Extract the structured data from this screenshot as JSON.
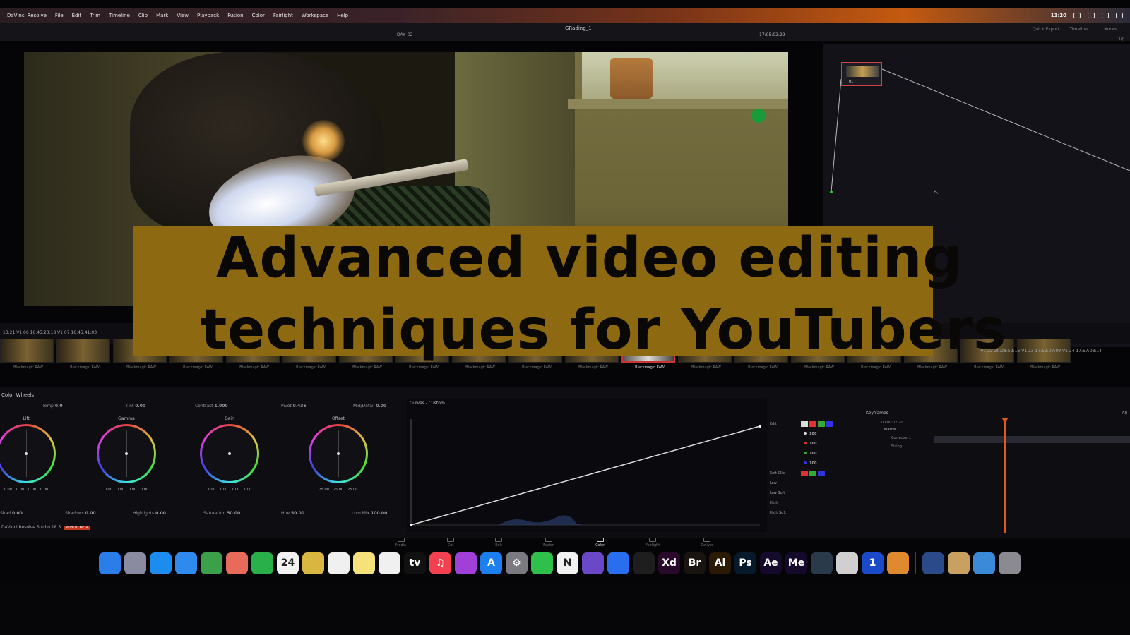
{
  "menubar": {
    "items": [
      "DaVinci Resolve",
      "File",
      "Edit",
      "Trim",
      "Timeline",
      "Clip",
      "Mark",
      "View",
      "Playback",
      "Fusion",
      "Color",
      "Fairlight",
      "Workspace",
      "Help"
    ],
    "clock": "11:20"
  },
  "toolbar": {
    "project": "GRading_1",
    "clip": "DAY_02",
    "timecode": "17:05:02:22",
    "quick_export": "Quick Export",
    "timeline_label": "Timeline",
    "nodes_label": "Nodes",
    "clip_label": "Clip"
  },
  "node": {
    "number": "01"
  },
  "banner": {
    "line1": "Advanced video editing",
    "line2": "techniques for YouTubers",
    "bg_color": "#8d6a12"
  },
  "timeline": {
    "left_tc": "13:21   V1   06   16:45:23:18   V1   07   16:45:41:03",
    "right_tc": "V1  22  20:28:52:16   V1  23  17:52:07:09   V1  24  17:57:08:14",
    "clip_label": "Blackmagic RAW",
    "selected_index": 11,
    "clip_count": 19
  },
  "color": {
    "panel_title": "Color Wheels",
    "params_top": [
      {
        "label": "Temp",
        "value": "0.0"
      },
      {
        "label": "Tint",
        "value": "0.00"
      },
      {
        "label": "Contrast",
        "value": "1.000"
      },
      {
        "label": "Pivot",
        "value": "0.435"
      },
      {
        "label": "Mid/Detail",
        "value": "0.00"
      }
    ],
    "wheels": [
      {
        "label": "Lift",
        "values": [
          "0.00",
          "0.00",
          "0.00",
          "0.00"
        ]
      },
      {
        "label": "Gamma",
        "values": [
          "0.00",
          "0.00",
          "0.00",
          "0.00"
        ]
      },
      {
        "label": "Gain",
        "values": [
          "1.00",
          "1.00",
          "1.00",
          "1.00"
        ]
      },
      {
        "label": "Offset",
        "values": [
          "25.00",
          "25.00",
          "25.00"
        ]
      }
    ],
    "params_bottom": [
      {
        "label": "Shad",
        "value": "0.00"
      },
      {
        "label": "Shadows",
        "value": "0.00"
      },
      {
        "label": "Highlights",
        "value": "0.00"
      },
      {
        "label": "Saturation",
        "value": "50.00"
      },
      {
        "label": "Hue",
        "value": "50.00"
      },
      {
        "label": "Lum Mix",
        "value": "100.00"
      }
    ],
    "curves_title": "Curves - Custom",
    "edit_label": "Edit",
    "edit_values": [
      "100",
      "100",
      "100",
      "100"
    ],
    "soft_clip_label": "Soft Clip",
    "soft_clip_rows": [
      "Low",
      "Low Soft",
      "High",
      "High Soft"
    ],
    "keyframes_title": "Keyframes",
    "keyframes_tc": "00:00:02:20",
    "keyframes_master": "Master",
    "keyframes_rows": [
      "Corrector 1",
      "Sizing"
    ],
    "keyframes_all": "All"
  },
  "pagetabs": [
    "Media",
    "Cut",
    "Edit",
    "Fusion",
    "Color",
    "Fairlight",
    "Deliver"
  ],
  "active_page": "Color",
  "studio": {
    "label": "DaVinci Resolve Studio 18.5",
    "badge": "PUBLIC BETA"
  },
  "dock": {
    "apps": [
      {
        "name": "finder",
        "glyph": "",
        "color": "#2b7de9"
      },
      {
        "name": "launchpad",
        "glyph": "",
        "color": "#8a8aa0"
      },
      {
        "name": "safari",
        "glyph": "",
        "color": "#1d8cf0"
      },
      {
        "name": "mail",
        "glyph": "",
        "color": "#2f8af0"
      },
      {
        "name": "maps",
        "glyph": "",
        "color": "#3ca04a"
      },
      {
        "name": "photos",
        "glyph": "",
        "color": "#e86a5a"
      },
      {
        "name": "facetime",
        "glyph": "",
        "color": "#2ab04a"
      },
      {
        "name": "calendar",
        "glyph": "24",
        "color": "#f2f2f2"
      },
      {
        "name": "notes-yellow",
        "glyph": "",
        "color": "#d8b640"
      },
      {
        "name": "reminders",
        "glyph": "",
        "color": "#f0f0f0"
      },
      {
        "name": "notes",
        "glyph": "",
        "color": "#f5e27a"
      },
      {
        "name": "freeform",
        "glyph": "",
        "color": "#f0f0f0"
      },
      {
        "name": "apple-tv",
        "glyph": "tv",
        "color": "#111111"
      },
      {
        "name": "music",
        "glyph": "♫",
        "color": "#f2404e"
      },
      {
        "name": "podcasts",
        "glyph": "",
        "color": "#a040d8"
      },
      {
        "name": "app-store",
        "glyph": "A",
        "color": "#1d7ef0"
      },
      {
        "name": "system-settings",
        "glyph": "⚙",
        "color": "#7a7a80"
      },
      {
        "name": "messages",
        "glyph": "",
        "color": "#2ec04a"
      },
      {
        "name": "notion",
        "glyph": "N",
        "color": "#f2f2f2"
      },
      {
        "name": "obsidian",
        "glyph": "",
        "color": "#6a48c8"
      },
      {
        "name": "toolbox",
        "glyph": "",
        "color": "#2a6ef0"
      },
      {
        "name": "figma",
        "glyph": "",
        "color": "#1e1e1e"
      },
      {
        "name": "adobe-xd",
        "glyph": "Xd",
        "color": "#2a0a2a"
      },
      {
        "name": "adobe-bridge",
        "glyph": "Br",
        "color": "#1a1410"
      },
      {
        "name": "adobe-illustrator",
        "glyph": "Ai",
        "color": "#2a1a04"
      },
      {
        "name": "adobe-photoshop",
        "glyph": "Ps",
        "color": "#071a2c"
      },
      {
        "name": "adobe-after-effects",
        "glyph": "Ae",
        "color": "#150a2c"
      },
      {
        "name": "adobe-media-encoder",
        "glyph": "Me",
        "color": "#150a2c"
      },
      {
        "name": "davinci-resolve",
        "glyph": "",
        "color": "#2a3a4a"
      },
      {
        "name": "disk-utility",
        "glyph": "",
        "color": "#d0d0d0"
      },
      {
        "name": "1password",
        "glyph": "1",
        "color": "#1a4ac8"
      },
      {
        "name": "firefox-ish",
        "glyph": "",
        "color": "#e08a30"
      },
      {
        "name": "quicktime",
        "glyph": "",
        "color": "#2a4a8a"
      },
      {
        "name": "preview",
        "glyph": "",
        "color": "#c8a060"
      },
      {
        "name": "downloads-folder",
        "glyph": "",
        "color": "#3a8ad8"
      },
      {
        "name": "trash",
        "glyph": "",
        "color": "#8a8a90"
      }
    ]
  }
}
